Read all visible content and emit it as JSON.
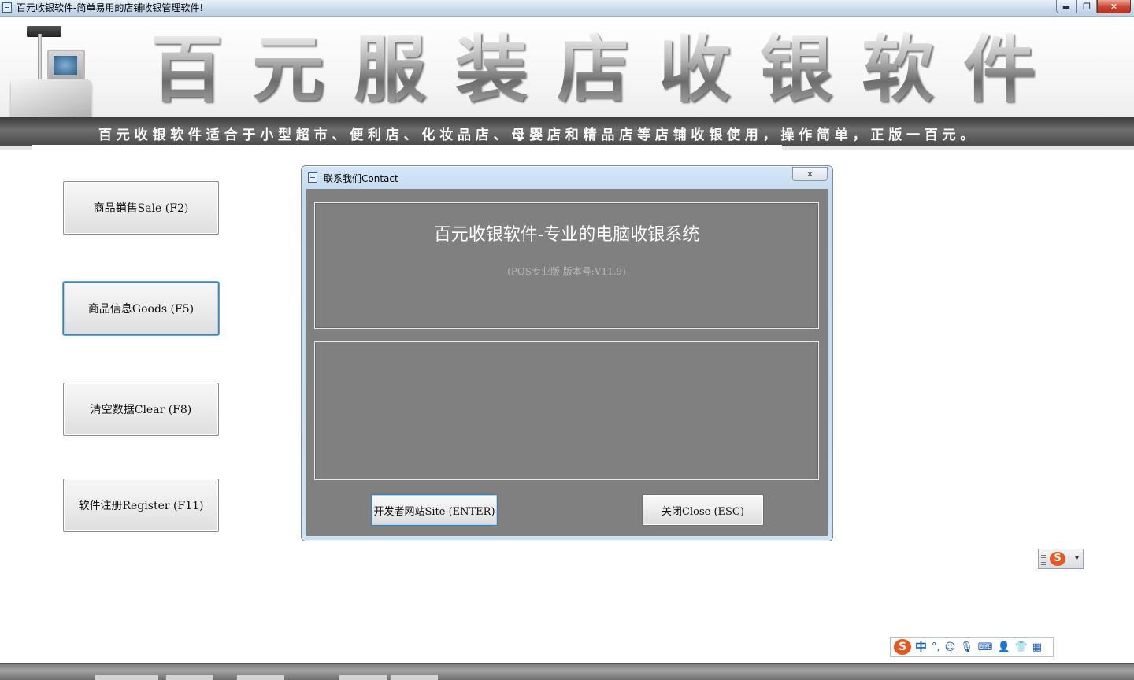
{
  "window": {
    "title": "百元收银软件-简单易用的店铺收银管理软件!",
    "minimize_label": "▬",
    "maximize_label": "❐",
    "close_label": "✕"
  },
  "banner": {
    "title_chars": [
      "百",
      "元",
      "服",
      "装",
      "店",
      "收",
      "银",
      "软",
      "件"
    ],
    "slogan": "百元收银软件适合于小型超市、便利店、化妆品店、母婴店和精品店等店铺收银使用，操作简单，正版一百元。"
  },
  "menu": {
    "sale": "商品销售Sale (F2)",
    "goods": "商品信息Goods (F5)",
    "clear": "清空数据Clear (F8)",
    "register": "软件注册Register (F11)"
  },
  "dialog": {
    "title": "联系我们Contact",
    "close_label": "✕",
    "heading": "百元收银软件-专业的电脑收银系统",
    "version": "(POS专业版 版本号:V11.9)",
    "site_button": "开发者网站Site (ENTER)",
    "close_button": "关闭Close (ESC)"
  },
  "ime": {
    "logo": "S",
    "lang": "中",
    "punct": "°,",
    "arrow": "▾",
    "icons": [
      "smiley-icon",
      "microphone-icon",
      "keyboard-icon",
      "user-icon",
      "shirt-icon",
      "grid-icon"
    ]
  },
  "colors": {
    "dialog_body": "#808080",
    "ime_accent": "#e8571f",
    "ime_blue": "#1a5fb4"
  }
}
